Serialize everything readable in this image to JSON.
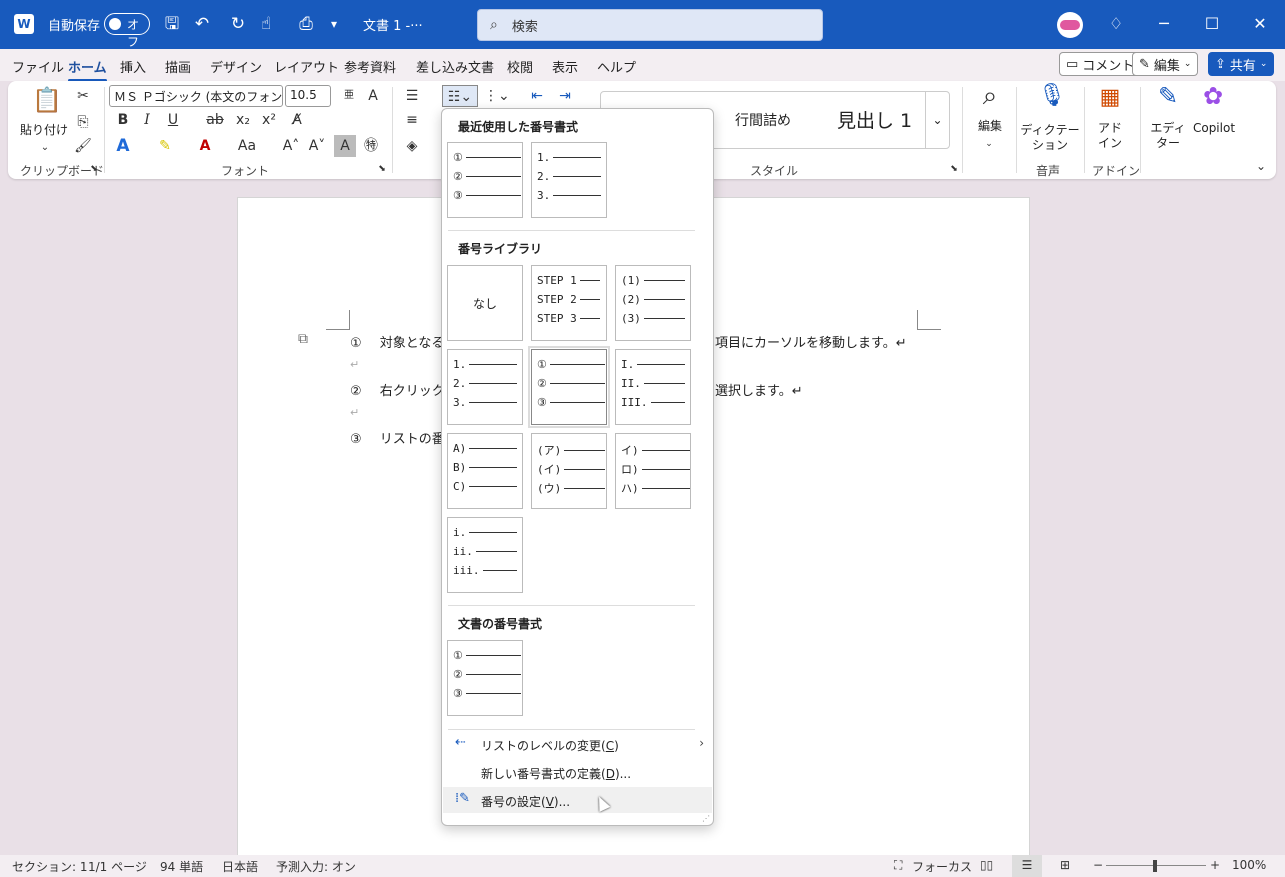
{
  "titlebar": {
    "app_icon": "word-icon",
    "autosave_label": "自動保存",
    "autosave_state": "オフ",
    "doc_title": "文書 1  -···",
    "search_placeholder": "検索"
  },
  "menu": {
    "tabs": [
      "ファイル",
      "ホーム",
      "挿入",
      "描画",
      "デザイン",
      "レイアウト",
      "参考資料",
      "差し込み文書",
      "校閲",
      "表示",
      "ヘルプ"
    ],
    "active_tab": "ホーム",
    "comment_label": "コメント",
    "edit_label": "編集",
    "share_label": "共有"
  },
  "ribbon": {
    "paste_label": "貼り付け",
    "clipboard_label": "クリップボード",
    "font_name": "ＭＳ Ｐゴシック (本文のフォント",
    "font_size": "10.5",
    "font_group_label": "フォント",
    "styles": [
      "行間詰め",
      "見出し 1"
    ],
    "style_group_label": "スタイル",
    "edit_btn": "編集",
    "dictate_btn": "ディクテー\nション",
    "voice_label": "音声",
    "addin_btn": "アド\nイン",
    "addin_label": "アドイン",
    "editor_btn": "エディ\nター",
    "copilot_btn": "Copilot"
  },
  "document": {
    "lines": [
      {
        "num": "①",
        "text": "対象となる",
        "tail": "項目にカーソルを移動します。↵"
      },
      {
        "num": "②",
        "text": "右クリックし",
        "tail": "選択します。↵"
      },
      {
        "num": "③",
        "text": "リストの番号",
        "tail": ""
      }
    ],
    "para_mark": "↵"
  },
  "dropdown": {
    "recent_heading": "最近使用した番号書式",
    "library_heading": "番号ライブラリ",
    "document_heading": "文書の番号書式",
    "none_label": "なし",
    "recent": [
      [
        "①",
        "②",
        "③"
      ],
      [
        "1.",
        "2.",
        "3."
      ]
    ],
    "library": [
      [
        "STEP 1",
        "STEP 2",
        "STEP 3"
      ],
      [
        "(1)",
        "(2)",
        "(3)"
      ],
      [
        "1.",
        "2.",
        "3."
      ],
      [
        "①",
        "②",
        "③"
      ],
      [
        "I.",
        "II.",
        "III."
      ],
      [
        "A)",
        "B)",
        "C)"
      ],
      [
        "(ア)",
        "(イ)",
        "(ウ)"
      ],
      [
        "イ)",
        "ロ)",
        "ハ)"
      ],
      [
        "i.",
        "ii.",
        "iii."
      ]
    ],
    "document_formats": [
      [
        "①",
        "②",
        "③"
      ]
    ],
    "change_level": "リストのレベルの変更(",
    "change_level_key": "C",
    "define_new": "新しい番号書式の定義(",
    "define_new_key": "D",
    "set_value": "番号の設定(",
    "set_value_key": "V",
    "ellipsis_close": ")...",
    "paren_close": ")"
  },
  "status": {
    "section": "セクション: 1",
    "pages": "1/1 ページ",
    "words": "94 単語",
    "language": "日本語",
    "predict": "予測入力: オン",
    "focus": "フォーカス",
    "zoom": "100%"
  }
}
